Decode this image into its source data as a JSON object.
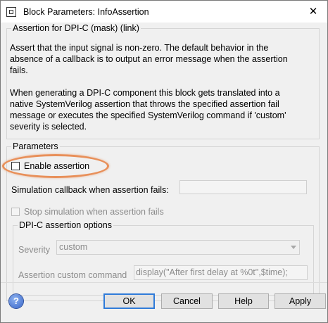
{
  "window": {
    "title": "Block Parameters: InfoAssertion"
  },
  "mask": {
    "legend": "Assertion for DPI-C (mask) (link)",
    "desc1_line1": "Assert that the input signal is non-zero. The default behavior in the",
    "desc1_line2": "absence of a callback is to output an error message when the assertion",
    "desc1_line3": "fails.",
    "desc2_line1": "When generating a DPI-C component this block gets translated into a",
    "desc2_line2": "native SystemVerilog assertion that throws the specified assertion fail",
    "desc2_line3": "message or executes the specified SystemVerilog command if 'custom'",
    "desc2_line4": "severity is selected."
  },
  "params": {
    "legend": "Parameters",
    "enable_label": "Enable assertion",
    "enable_checked": false,
    "sim_callback_label": "Simulation callback when assertion fails:",
    "sim_callback_value": "",
    "stop_label": "Stop simulation when assertion fails",
    "dpi_legend": "DPI-C assertion options",
    "severity_label": "Severity",
    "severity_value": "custom",
    "custom_cmd_label": "Assertion custom command",
    "custom_cmd_value": "display(\"After first delay at %0t\",$time);"
  },
  "footer": {
    "help_icon": "?",
    "ok": "OK",
    "cancel": "Cancel",
    "help": "Help",
    "apply": "Apply"
  },
  "colors": {
    "highlight": "#e8905a",
    "default_button_border": "#2f7bd9"
  }
}
